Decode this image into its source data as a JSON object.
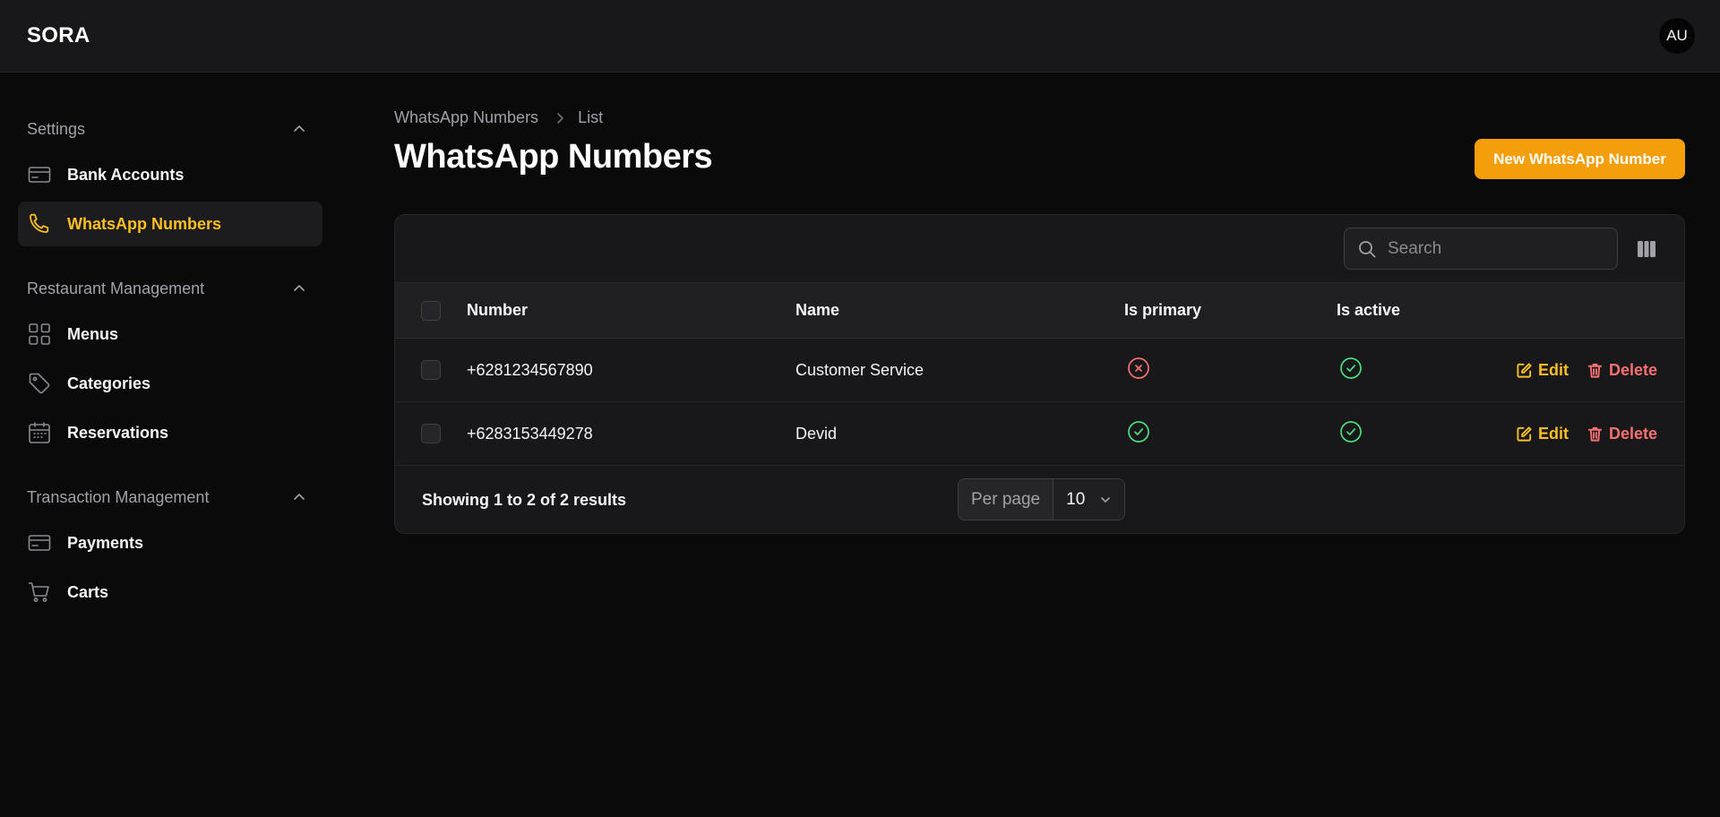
{
  "app": {
    "brand": "SORA",
    "avatar_initials": "AU"
  },
  "sidebar": {
    "groups": [
      {
        "label": "Settings",
        "items": [
          {
            "label": "Bank Accounts",
            "icon": "credit-card-icon",
            "active": false
          },
          {
            "label": "WhatsApp Numbers",
            "icon": "phone-icon",
            "active": true
          }
        ]
      },
      {
        "label": "Restaurant Management",
        "items": [
          {
            "label": "Menus",
            "icon": "grid-icon",
            "active": false
          },
          {
            "label": "Categories",
            "icon": "tag-icon",
            "active": false
          },
          {
            "label": "Reservations",
            "icon": "calendar-icon",
            "active": false
          }
        ]
      },
      {
        "label": "Transaction Management",
        "items": [
          {
            "label": "Payments",
            "icon": "credit-card-icon",
            "active": false
          },
          {
            "label": "Carts",
            "icon": "cart-icon",
            "active": false
          }
        ]
      }
    ]
  },
  "breadcrumb": [
    "WhatsApp Numbers",
    "List"
  ],
  "page": {
    "title": "WhatsApp Numbers",
    "new_button": "New WhatsApp Number"
  },
  "table": {
    "search_placeholder": "Search",
    "columns": [
      "Number",
      "Name",
      "Is primary",
      "Is active"
    ],
    "rows": [
      {
        "number": "+6281234567890",
        "name": "Customer Service",
        "is_primary": false,
        "is_active": true
      },
      {
        "number": "+6283153449278",
        "name": "Devid",
        "is_primary": true,
        "is_active": true
      }
    ],
    "actions": {
      "edit": "Edit",
      "delete": "Delete"
    },
    "footer": {
      "results": "Showing 1 to 2 of 2 results",
      "per_page_label": "Per page",
      "per_page_value": "10"
    }
  },
  "colors": {
    "accent": "#f59e0b",
    "success": "#4ade80",
    "danger": "#f87171"
  }
}
